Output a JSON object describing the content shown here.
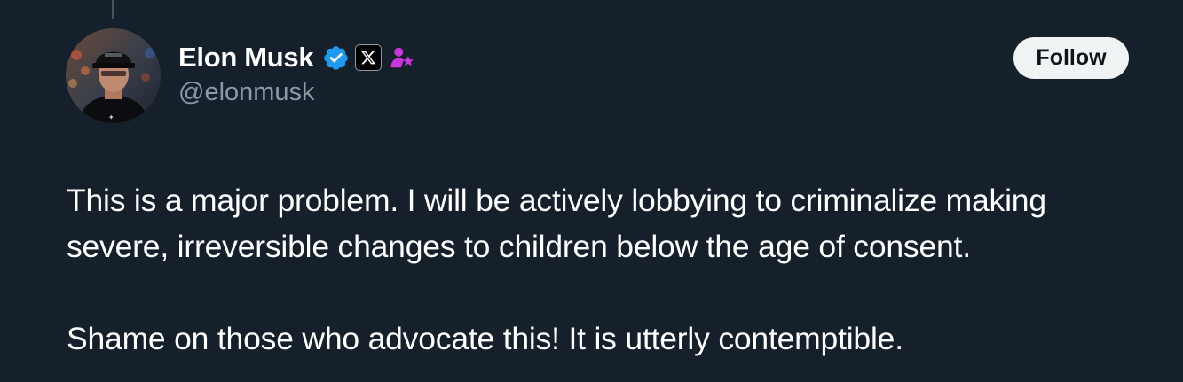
{
  "author": {
    "display_name": "Elon Musk",
    "handle": "@elonmusk",
    "verified_color": "#1d9bf0",
    "affiliate_color": "#c936e0",
    "icons": [
      "verified-badge-icon",
      "x-logo-icon",
      "affiliate-badge-icon"
    ]
  },
  "follow_button": {
    "label": "Follow"
  },
  "tweet": {
    "line_1": "This is a major problem. I will be actively lobbying to criminalize making",
    "line_2": "severe, irreversible changes to children below the age of consent.",
    "line_3": "Shame on those who advocate this! It is utterly contemptible."
  },
  "colors": {
    "background": "#15202b",
    "text_primary": "#ffffff",
    "text_secondary": "#8b98a5",
    "button_bg": "#eff3f4",
    "button_text": "#0f1419"
  }
}
